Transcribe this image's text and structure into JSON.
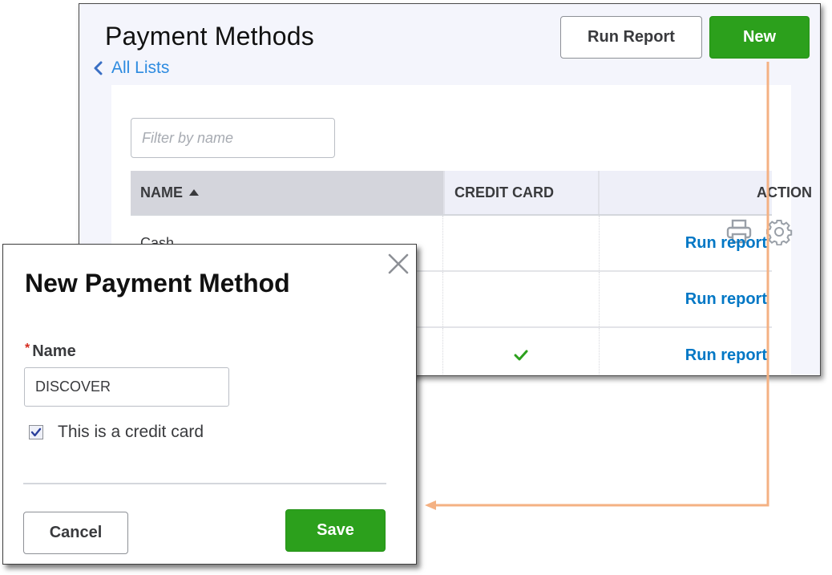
{
  "page": {
    "title": "Payment Methods",
    "breadcrumb": "All Lists",
    "buttons": {
      "run_report": "Run Report",
      "new": "New"
    },
    "filter": {
      "placeholder": "Filter by name",
      "value": ""
    },
    "toolbar_icons": [
      "print-icon",
      "gear-icon"
    ],
    "table": {
      "columns": [
        {
          "label": "NAME",
          "sort": "ascending"
        },
        {
          "label": "CREDIT CARD"
        },
        {
          "label": "ACTION"
        }
      ],
      "rows": [
        {
          "name": "Cash",
          "credit_card": false,
          "action": "Run report"
        },
        {
          "name": "",
          "credit_card": false,
          "action": "Run report"
        },
        {
          "name": "",
          "credit_card": true,
          "action": "Run report"
        }
      ]
    }
  },
  "modal": {
    "title": "New Payment Method",
    "name_label": "Name",
    "required_marker": "*",
    "name_value": "DISCOVER",
    "credit_card_checkbox": {
      "label": "This is a credit card",
      "checked": true
    },
    "buttons": {
      "cancel": "Cancel",
      "save": "Save"
    }
  },
  "colors": {
    "primary_green": "#2ca01c",
    "link_blue": "#0077c5",
    "breadcrumb_blue": "#2d8be0",
    "required_red": "#d52b1e",
    "annotation_orange": "#f4b183"
  }
}
